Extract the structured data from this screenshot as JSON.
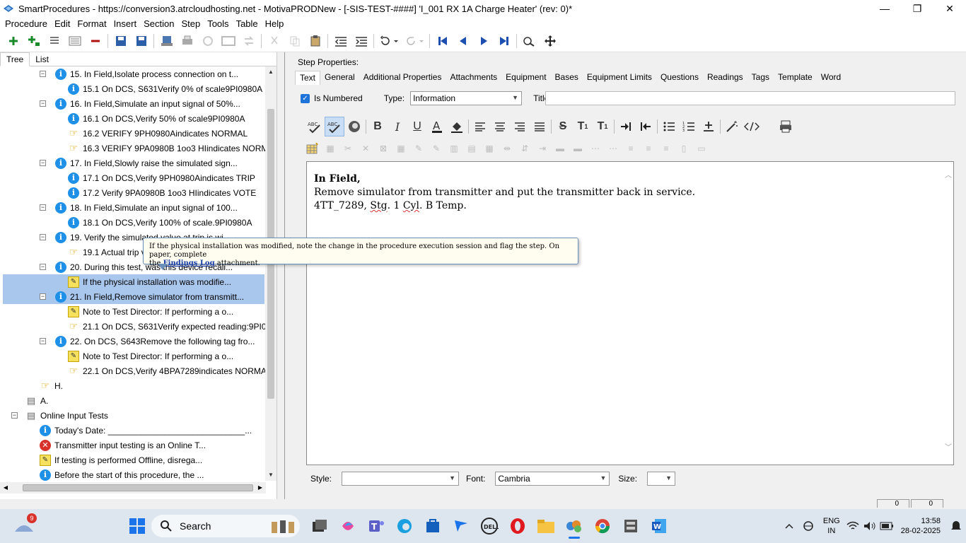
{
  "window": {
    "title": "SmartProcedures - https://conversion3.atrcloudhosting.net - MotivaPRODNew - [-SIS-TEST-####] 'I_001 RX 1A Charge Heater' (rev: 0)*",
    "minimize": "—",
    "maximize": "❐",
    "close": "✕"
  },
  "menu": [
    "Procedure",
    "Edit",
    "Format",
    "Insert",
    "Section",
    "Step",
    "Tools",
    "Table",
    "Help"
  ],
  "left": {
    "tabs": [
      "Tree",
      "List"
    ],
    "tree": [
      {
        "icon": "info",
        "text": "15. In Field,Isolate process connection on t...",
        "expand": "−",
        "level": 0
      },
      {
        "icon": "info",
        "text": "15.1 On DCS, S631Verify 0% of scale9PI0980A",
        "level": 1
      },
      {
        "icon": "info",
        "text": "16. In Field,Simulate an input signal of 50%...",
        "expand": "−",
        "level": 0
      },
      {
        "icon": "info",
        "text": "16.1 On DCS,Verify 50% of scale9PI0980A",
        "level": 1
      },
      {
        "icon": "hand",
        "text": "16.2 VERIFY 9PH0980Aindicates NORMAL",
        "level": 1
      },
      {
        "icon": "hand",
        "text": "16.3 VERIFY 9PA0980B 1oo3 HIindicates NORMAL",
        "level": 1
      },
      {
        "icon": "info",
        "text": "17. In Field,Slowly raise the simulated sign...",
        "expand": "−",
        "level": 0
      },
      {
        "icon": "info",
        "text": "17.1 On DCS,Verify 9PH0980Aindicates TRIP",
        "level": 1
      },
      {
        "icon": "info",
        "text": "17.2 Verify 9PA0980B 1oo3 HIindicates VOTE",
        "level": 1
      },
      {
        "icon": "info",
        "text": "18. In Field,Simulate an input signal of 100...",
        "expand": "−",
        "level": 0
      },
      {
        "icon": "info",
        "text": "18.1 On DCS,Verify 100% of scale.9PI0980A",
        "level": 1
      },
      {
        "icon": "info",
        "text": "19. Verify the simulated value at trip is wi...",
        "expand": "−",
        "level": 0
      },
      {
        "icon": "hand",
        "text": "19.1 Actual trip value",
        "level": 1
      },
      {
        "icon": "info",
        "text": "20. During this test, was this device recali...",
        "expand": "−",
        "level": 0
      },
      {
        "icon": "note",
        "text": "If the physical installation was modifie...",
        "level": 1,
        "selected": true
      },
      {
        "icon": "info",
        "text": "21. In Field,Remove simulator from transmitt...",
        "expand": "−",
        "level": 0,
        "selected": true
      },
      {
        "icon": "note",
        "text": "Note to Test Director: If performing a o...",
        "level": 1
      },
      {
        "icon": "hand",
        "text": "21.1 On DCS, S631Verify expected reading:9PI0...",
        "level": 1
      },
      {
        "icon": "info",
        "text": "22. On DCS, S643Remove the following tag fro...",
        "expand": "−",
        "level": 0
      },
      {
        "icon": "note",
        "text": "Note to Test Director: If performing a o...",
        "level": 1
      },
      {
        "icon": "hand",
        "text": "22.1 On DCS,Verify 4BPA7289indicates NORMAL",
        "level": 1
      },
      {
        "icon": "hand",
        "text": "H.",
        "level": -1
      },
      {
        "icon": "doc",
        "text": "A.",
        "level": -2
      },
      {
        "icon": "doc",
        "text": "Online Input Tests",
        "expand": "−",
        "level": -3
      },
      {
        "icon": "info",
        "text": "Today's Date: _____________________________...",
        "level": -1
      },
      {
        "icon": "err",
        "text": "Transmitter input testing is an Online T...",
        "level": -1
      },
      {
        "icon": "note",
        "text": "If testing is performed Offline, disrega...",
        "level": -1
      },
      {
        "icon": "info",
        "text": "Before the start of this procedure, the ...",
        "level": -1
      }
    ]
  },
  "right": {
    "step_properties_label": "Step Properties:",
    "tabs": [
      "Text",
      "General",
      "Additional Properties",
      "Attachments",
      "Equipment",
      "Bases",
      "Equipment Limits",
      "Questions",
      "Readings",
      "Tags",
      "Template",
      "Word"
    ],
    "is_numbered_label": "Is Numbered",
    "type_label": "Type:",
    "type_value": "Information",
    "title_label": "Title:",
    "title_value": "",
    "editor": {
      "line1": "In Field,",
      "line2": "Remove simulator from transmitter and put the transmitter back in service.",
      "line3_a": "4TT_7289, ",
      "line3_b": "Stg",
      "line3_c": ". 1 ",
      "line3_d": "Cyl",
      "line3_e": ". B Temp."
    },
    "style_label": "Style:",
    "style_value": "",
    "font_label": "Font:",
    "font_value": "Cambria",
    "size_label": "Size:",
    "size_value": ""
  },
  "tooltip": {
    "text1": "If the physical installation was modified, note the change in the procedure execution session and flag the step. On paper, complete",
    "text2": "the ",
    "link": "Findings Log",
    "text3": " attachment."
  },
  "status": [
    "0",
    "0"
  ],
  "taskbar": {
    "notification_count": "9",
    "search_label": "Search",
    "lang_1": "ENG",
    "lang_2": "IN",
    "time": "13:58",
    "date": "28-02-2025"
  }
}
